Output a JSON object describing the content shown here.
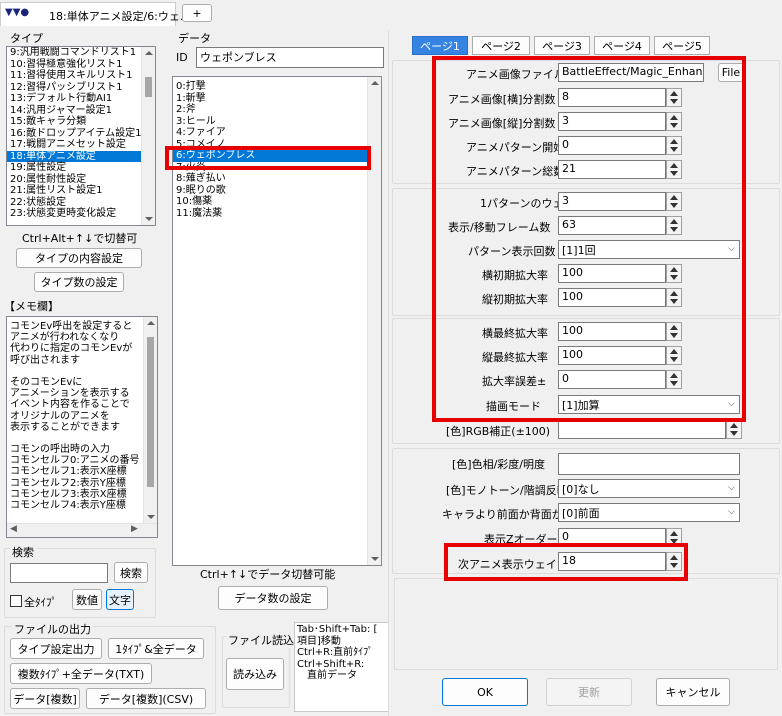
{
  "window": {
    "title": "18:単体アニメ設定/6:ウェ...",
    "add_tab": "+"
  },
  "type_panel": {
    "label": "タイプ",
    "items": [
      "9:汎用戦闘コマンドリスト1",
      "10:習得極意強化リスト1",
      "11:習得使用スキルリスト1",
      "12:習得パッシブリスト1",
      "13:デフォルト行動AI1",
      "14:汎用ジャマー設定1",
      "15:敵キャラ分類",
      "16:敵ドロップアイテム設定1",
      "17:戦闘アニメセット設定",
      "18:単体アニメ設定",
      "19:属性設定",
      "20:属性耐性設定",
      "21:属性リスト設定1",
      "22:状態設定",
      "23:状態変更時変化設定"
    ],
    "selected_index": 9,
    "hint": "Ctrl+Alt+↑↓で切替可",
    "content_button": "タイプの内容設定",
    "count_button": "タイプ数の設定"
  },
  "memo": {
    "label": "【メモ欄】",
    "lines": [
      "コモンEv呼出を設定すると",
      "アニメが行われなくなり",
      "代わりに指定のコモンEvが",
      "呼び出されます",
      "",
      "そのコモンEvに",
      "アニメーションを表示する",
      "イベント内容を作ることで",
      "オリジナルのアニメを",
      "表示することができます",
      "",
      "コモンの呼出時の入力",
      "コモンセルフ0:アニメの番号",
      "コモンセルフ1:表示X座標",
      "コモンセルフ2:表示Y座標",
      "コモンセルフ3:表示X座標",
      "コモンセルフ4:表示Y座標"
    ]
  },
  "search": {
    "label": "検索",
    "value": "",
    "button": "検索",
    "all_types_label": "全ﾀｲﾌﾟ",
    "numeric_button": "数値",
    "text_button": "文字"
  },
  "file_output": {
    "label": "ファイルの出力",
    "type_output": "タイプ設定出力",
    "one_type_all": "1ﾀｲﾌﾟ&全データ",
    "multi_type_all": "複数ﾀｲﾌﾟ+全データ(TXT)",
    "data_multi": "データ[複数]",
    "data_multi_csv": "データ[複数](CSV)"
  },
  "file_read": {
    "label": "ファイル読込",
    "button": "読み込み"
  },
  "shortcuts": [
    "Tab･Shift+Tab: [",
    "項目]移動",
    "Ctrl+R:直前ﾀｲﾌﾟ",
    "Ctrl+Shift+R:",
    "　直前データ"
  ],
  "data_panel": {
    "label": "データ",
    "id_label": "ID",
    "name_value": "ウェポンブレス",
    "items": [
      "0:打撃",
      "1:斬撃",
      "2:斧",
      "3:ヒール",
      "4:ファイア",
      "5:コメイノ",
      "6:ウェポンブレス",
      "7:火炎",
      "8:薙ぎ払い",
      "9:眠りの歌",
      "10:傷薬",
      "11:魔法薬"
    ],
    "selected_index": 6,
    "hint": "Ctrl+↑↓でデータ切替可能",
    "count_button": "データ数の設定"
  },
  "pages": {
    "tabs": [
      "ページ1",
      "ページ2",
      "ページ3",
      "ページ4",
      "ページ5"
    ],
    "active": 0
  },
  "fields": {
    "anim_file_label": "アニメ画像ファイル",
    "anim_file_value": "BattleEffect/Magic_Enhance",
    "file_button": "File",
    "h_div_label": "アニメ画像[横]分割数",
    "h_div_value": "8",
    "v_div_label": "アニメ画像[縦]分割数",
    "v_div_value": "3",
    "pattern_start_label": "アニメパターン開始",
    "pattern_start_value": "0",
    "pattern_total_label": "アニメパターン総数",
    "pattern_total_value": "21",
    "wait_label": "1パターンのウェイト",
    "wait_value": "3",
    "frames_label": "表示/移動フレーム数",
    "frames_value": "63",
    "repeat_label": "パターン表示回数",
    "repeat_value": "[1]1回",
    "h_init_label": "横初期拡大率",
    "h_init_value": "100",
    "v_init_label": "縦初期拡大率",
    "v_init_value": "100",
    "h_final_label": "横最終拡大率",
    "h_final_value": "100",
    "v_final_label": "縦最終拡大率",
    "v_final_value": "100",
    "scale_err_label": "拡大率誤差±",
    "scale_err_value": "0",
    "draw_mode_label": "描画モード",
    "draw_mode_value": "[1]加算",
    "rgb_label": "[色]RGB補正(±100)",
    "rgb_value": "",
    "hsv_label": "[色]色相/彩度/明度",
    "hsv_value": "",
    "mono_label": "[色]モノトーン/階調反転",
    "mono_value": "[0]なし",
    "front_label": "キャラより前面か背面か",
    "front_value": "[0]前面",
    "z_label": "表示Zオーダー",
    "z_value": "0",
    "next_wait_label": "次アニメ表示ウェイト",
    "next_wait_value": "18"
  },
  "dialog": {
    "ok": "OK",
    "update": "更新",
    "cancel": "キャンセル"
  },
  "colors": {
    "accent": "#3584e4",
    "selection": "#0078d7",
    "highlight_box": "#e60000"
  }
}
